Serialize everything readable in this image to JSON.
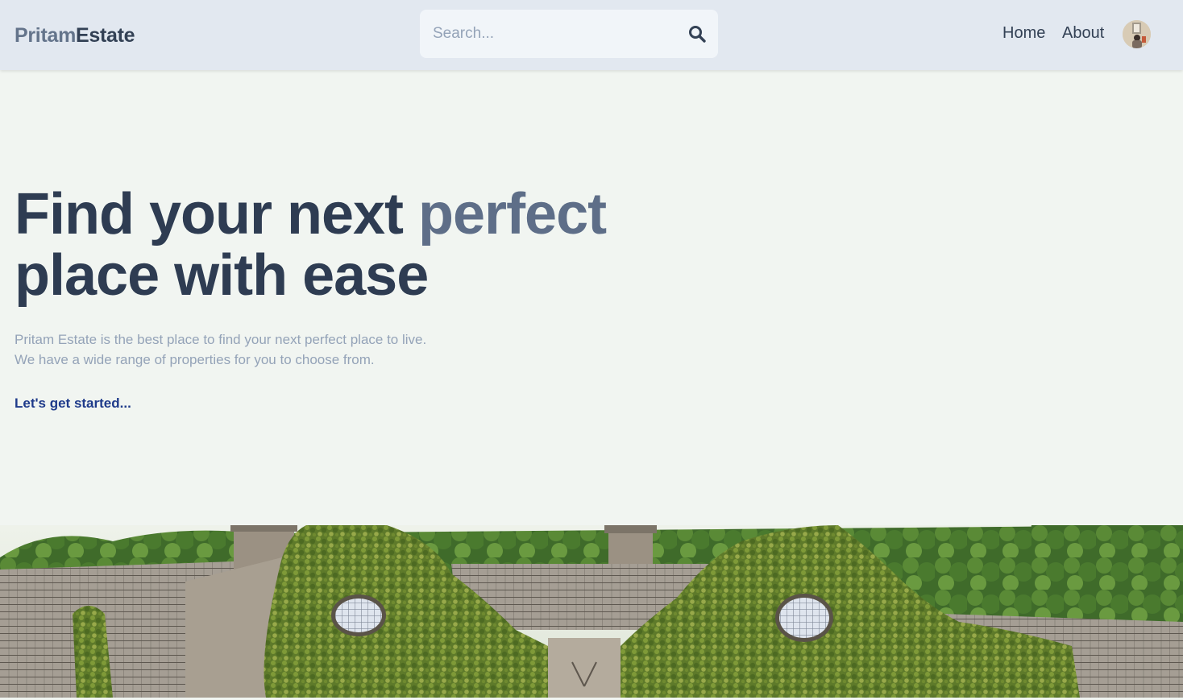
{
  "header": {
    "logo_part1": "Pritam",
    "logo_part2": "Estate",
    "search_placeholder": "Search...",
    "nav": [
      {
        "label": "Home"
      },
      {
        "label": "About"
      }
    ]
  },
  "hero": {
    "title_line1_start": "Find your next ",
    "title_line1_accent": "perfect",
    "title_line2": "place with ease",
    "description_line1": "Pritam Estate is the best place to find your next perfect place to live.",
    "description_line2": "We have a wide range of properties for you to choose from.",
    "cta_label": "Let's get started..."
  },
  "icons": {
    "search": "search-icon",
    "avatar": "avatar"
  },
  "colors": {
    "header_bg": "#e2e8f0",
    "page_bg": "#f1f5f1",
    "title_dark": "#2e3c52",
    "title_accent": "#5e6e88",
    "cta": "#1e3a8a"
  }
}
